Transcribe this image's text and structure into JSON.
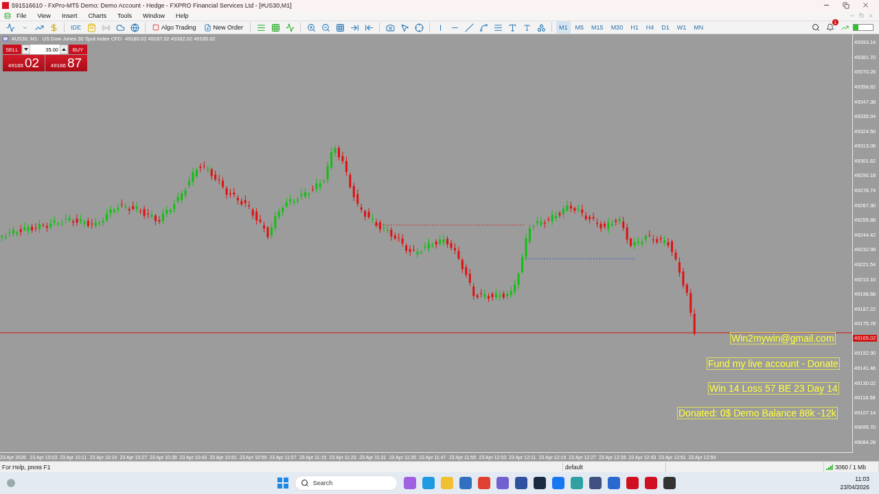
{
  "window": {
    "title": "591516610 - FxPro-MT5 Demo: Demo Account - Hedge - FXPRO Financial Services Ltd - [#US30,M1]"
  },
  "menu": [
    "File",
    "View",
    "Insert",
    "Charts",
    "Tools",
    "Window",
    "Help"
  ],
  "toolbar": {
    "ide": "IDE",
    "buttons": [
      {
        "kind": "algo",
        "label": "Algo Trading"
      },
      {
        "kind": "order",
        "label": "New Order"
      }
    ],
    "timeframes": [
      {
        "label": "M1",
        "selected": true
      },
      {
        "label": "M5",
        "selected": false
      },
      {
        "label": "M15",
        "selected": false
      },
      {
        "label": "M30",
        "selected": false
      },
      {
        "label": "H1",
        "selected": false
      },
      {
        "label": "H4",
        "selected": false
      },
      {
        "label": "D1",
        "selected": false
      },
      {
        "label": "W1",
        "selected": false
      },
      {
        "label": "MN",
        "selected": false
      }
    ],
    "notification_count": "1"
  },
  "chart": {
    "symbol": "#US30, M1:",
    "description": "US Dow Jones 30 Spot Index CFD",
    "ohlc": "49180.02 49187.02 49162.02 49165.02",
    "trade_panel": {
      "sell": "SELL",
      "volume": "35.00",
      "buy": "BUY",
      "bid_main": "49165",
      "bid_big": "02",
      "ask_main": "49166",
      "ask_big": "87"
    },
    "price_ticks": [
      "49393.14",
      "49381.70",
      "49370.26",
      "49358.82",
      "49347.38",
      "49335.94",
      "49324.50",
      "49313.06",
      "49301.62",
      "49290.18",
      "49278.74",
      "49267.30",
      "49255.86",
      "49244.42",
      "49232.98",
      "49221.54",
      "49210.10",
      "49198.66",
      "49187.22",
      "49175.78",
      "49152.90",
      "49141.46",
      "49130.02",
      "49118.58",
      "49107.14",
      "49095.70",
      "49084.26"
    ],
    "current_price": "49165.02",
    "time_ticks": [
      "23 Apr 2026",
      "23 Apr 10:03",
      "23 Apr 10:11",
      "23 Apr 10:19",
      "23 Apr 10:27",
      "23 Apr 10:35",
      "23 Apr 10:43",
      "23 Apr 10:51",
      "23 Apr 10:59",
      "23 Apr 11:07",
      "23 Apr 11:15",
      "23 Apr 11:23",
      "23 Apr 11:31",
      "23 Apr 11:39",
      "23 Apr 11:47",
      "23 Apr 11:55",
      "23 Apr 12:03",
      "23 Apr 12:11",
      "23 Apr 12:19",
      "23 Apr 12:27",
      "23 Apr 12:35",
      "23 Apr 12:43",
      "23 Apr 12:51",
      "23 Apr 12:59"
    ],
    "notes": [
      "Win2mywin@gmail.com",
      "Fund my live account - Donate",
      "Win 14  Loss 57  BE 23  Day 14",
      "Donated: 0$  Demo Balance 88k -12k"
    ]
  },
  "status_bar": {
    "help": "For Help, press F1",
    "profile": "default",
    "traffic": "3060 / 1 Mb"
  },
  "taskbar": {
    "search_placeholder": "Search",
    "time": "11:03",
    "date": "23/04/2026"
  }
}
